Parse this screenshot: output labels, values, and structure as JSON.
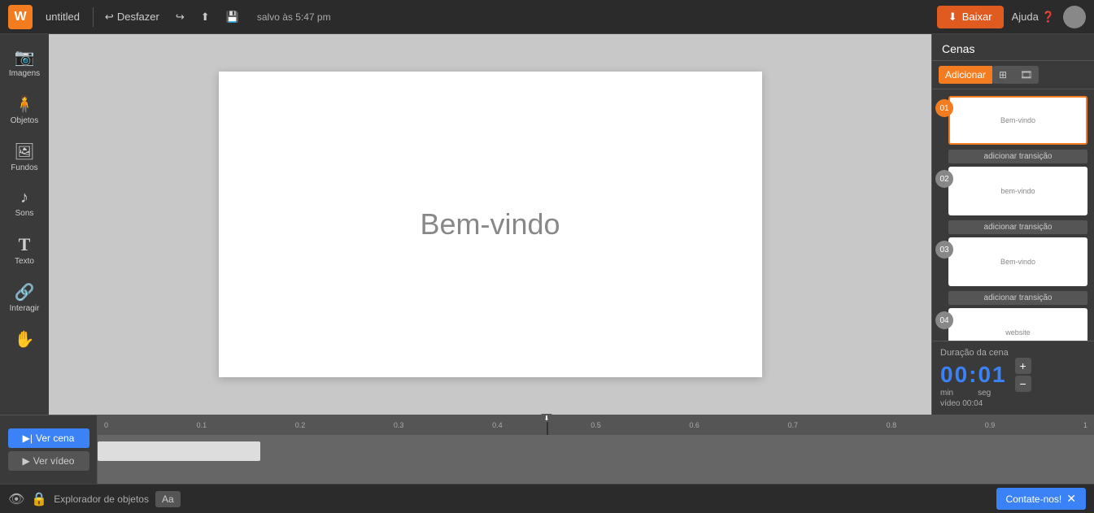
{
  "topbar": {
    "logo": "W",
    "title": "untitled",
    "undo_label": "Desfazer",
    "redo_label": "",
    "share_label": "",
    "save_label": "salvo às 5:47 pm",
    "download_label": "Baixar",
    "help_label": "Ajuda"
  },
  "sidebar": {
    "items": [
      {
        "id": "imagens",
        "icon": "📷",
        "label": "Imagens"
      },
      {
        "id": "objetos",
        "icon": "🧍",
        "label": "Objetos"
      },
      {
        "id": "fundos",
        "icon": "🖼",
        "label": "Fundos"
      },
      {
        "id": "sons",
        "icon": "♪",
        "label": "Sons"
      },
      {
        "id": "texto",
        "icon": "T",
        "label": "Texto"
      },
      {
        "id": "interagir",
        "icon": "🔗",
        "label": "Interagir"
      },
      {
        "id": "mover",
        "icon": "✋",
        "label": ""
      }
    ]
  },
  "canvas": {
    "text": "Bem-vindo"
  },
  "scenes": {
    "title": "Cenas",
    "tabs": [
      {
        "id": "add",
        "label": "Adicionar",
        "active": true
      },
      {
        "id": "grid",
        "label": "⊞",
        "active": false
      },
      {
        "id": "film",
        "label": "🎞",
        "active": false
      }
    ],
    "items": [
      {
        "number": "01",
        "text": "Bem-vindo",
        "active": true,
        "transition": "adicionar transição"
      },
      {
        "number": "02",
        "text": "bem-vindo",
        "active": false,
        "transition": "adicionar transição"
      },
      {
        "number": "03",
        "text": "Bem-vindo",
        "active": false,
        "transition": "adicionar transição"
      },
      {
        "number": "04",
        "text": "website",
        "active": false,
        "transition": ""
      }
    ]
  },
  "timeline": {
    "play_scene_label": "Ver cena",
    "play_video_label": "Ver vídeo",
    "ruler_marks": [
      "0",
      "0.1",
      "0.2",
      "0.3",
      "0.4",
      "0.5",
      "0.6",
      "0.7",
      "0.8",
      "0.9",
      "1"
    ],
    "duration_label": "Duração da cena",
    "duration_time": "00:01",
    "min_label": "min",
    "seg_label": "seg",
    "video_duration": "vídeo 00:04"
  },
  "bottombar": {
    "explorer_label": "Explorador de objetos",
    "font_label": "Aa",
    "contate_label": "Contate-nos!"
  }
}
